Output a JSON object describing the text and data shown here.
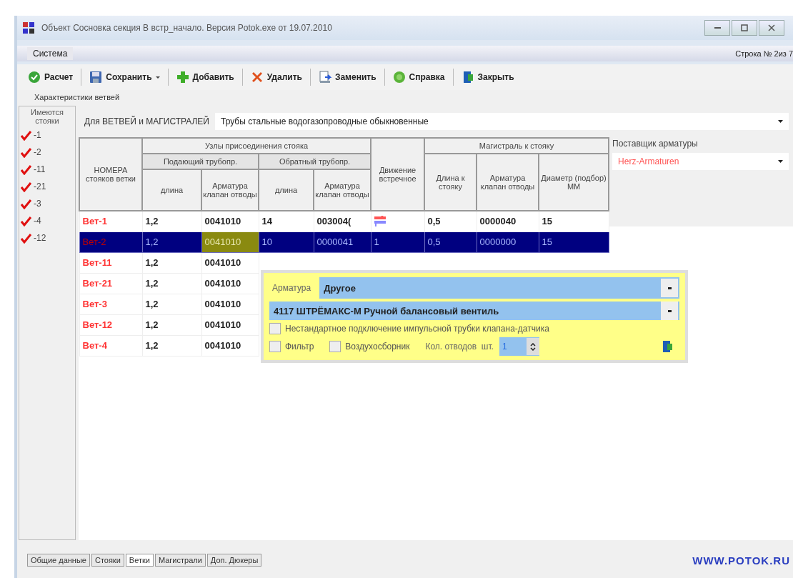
{
  "window": {
    "title": "Объект Сосновка секция В встр_начало. Версия Potok.exe от 19.07.2010"
  },
  "menu": [
    {
      "label": "Система"
    }
  ],
  "row_indicator": "Строка № 2из 7",
  "toolbar": [
    {
      "label": "Расчет",
      "dropdown": false
    },
    {
      "label": "Сохранить",
      "dropdown": true
    },
    {
      "label": "Добавить",
      "dropdown": false
    },
    {
      "label": "Удалить",
      "dropdown": false
    },
    {
      "label": "Заменить",
      "dropdown": false
    },
    {
      "label": "Справка",
      "dropdown": false
    },
    {
      "label": "Закрыть",
      "dropdown": false
    }
  ],
  "group_title": "Характеристики ветвей",
  "risers": {
    "title": "Имеются стояки",
    "items": [
      {
        "label": "-1",
        "checked": true
      },
      {
        "label": "-2",
        "checked": true
      },
      {
        "label": "-11",
        "checked": true
      },
      {
        "label": "-21",
        "checked": true
      },
      {
        "label": "-3",
        "checked": true
      },
      {
        "label": "-4",
        "checked": true
      },
      {
        "label": "-12",
        "checked": true
      }
    ]
  },
  "pipes": {
    "label": "Для ВЕТВЕЙ и МАГИСТРАЛЕЙ",
    "value": "Трубы стальные водогазопроводные обыкновенные"
  },
  "supplier": {
    "label": "Поставщик арматуры",
    "value": "Herz-Armaturen"
  },
  "table": {
    "header_rows": [
      [
        {
          "label": "НОМЕРА стояков ветки",
          "rowspan": 3
        },
        {
          "label": "Узлы присоединения стояка",
          "colspan": 4
        },
        {
          "label": "Движение встречное",
          "rowspan": 3
        },
        {
          "label": "Магистраль к стояку",
          "colspan": 3
        }
      ],
      [
        {
          "label": "Подающий трубопр.",
          "colspan": 2
        },
        {
          "label": "Обратный трубопр.",
          "colspan": 2
        },
        {
          "label": "Длина к стояку",
          "rowspan": 2
        },
        {
          "label": "Арматура клапан отводы",
          "rowspan": 2
        },
        {
          "label": "Диаметр (подбор) ММ",
          "rowspan": 2
        }
      ],
      [
        {
          "label": "длина"
        },
        {
          "label": "Арматура клапан отводы"
        },
        {
          "label": "длина"
        },
        {
          "label": "Арматура клапан отводы"
        }
      ]
    ],
    "rows": [
      {
        "selected": false,
        "cells": [
          {
            "kind": "name",
            "text": "Вет-1"
          },
          {
            "kind": "text",
            "text": "1,2"
          },
          {
            "kind": "text",
            "text": "0041010"
          },
          {
            "kind": "text",
            "text": "14"
          },
          {
            "kind": "text",
            "text": "003004("
          },
          {
            "kind": "flow"
          },
          {
            "kind": "text",
            "text": "0,5"
          },
          {
            "kind": "text",
            "text": "0000040"
          },
          {
            "kind": "text",
            "text": "15"
          }
        ]
      },
      {
        "selected": true,
        "cells": [
          {
            "kind": "name",
            "text": "Вет-2"
          },
          {
            "kind": "text",
            "text": "1,2"
          },
          {
            "kind": "text",
            "text": "0041010",
            "focused": true
          },
          {
            "kind": "text",
            "text": "10"
          },
          {
            "kind": "text",
            "text": "0000041"
          },
          {
            "kind": "text",
            "text": "1"
          },
          {
            "kind": "text",
            "text": "0,5"
          },
          {
            "kind": "text",
            "text": "0000000"
          },
          {
            "kind": "text",
            "text": "15"
          }
        ]
      },
      {
        "selected": false,
        "cells": [
          {
            "kind": "name",
            "text": "Вет-11"
          },
          {
            "kind": "text",
            "text": "1,2"
          },
          {
            "kind": "text",
            "text": "0041010"
          }
        ]
      },
      {
        "selected": false,
        "cells": [
          {
            "kind": "name",
            "text": "Вет-21"
          },
          {
            "kind": "text",
            "text": "1,2"
          },
          {
            "kind": "text",
            "text": "0041010"
          }
        ]
      },
      {
        "selected": false,
        "cells": [
          {
            "kind": "name",
            "text": "Вет-3"
          },
          {
            "kind": "text",
            "text": "1,2"
          },
          {
            "kind": "text",
            "text": "0041010"
          }
        ]
      },
      {
        "selected": false,
        "cells": [
          {
            "kind": "name",
            "text": "Вет-12"
          },
          {
            "kind": "text",
            "text": "1,2"
          },
          {
            "kind": "text",
            "text": "0041010"
          }
        ]
      },
      {
        "selected": false,
        "cells": [
          {
            "kind": "name",
            "text": "Вет-4"
          },
          {
            "kind": "text",
            "text": "1,2"
          },
          {
            "kind": "text",
            "text": "0041010"
          }
        ]
      }
    ]
  },
  "popup": {
    "fitting_label": "Арматура",
    "fitting_type": "Другое",
    "fitting_model": "4117 ШТРЁМАКС-М Ручной балансовый вентиль",
    "nonstandard": {
      "label": "Нестандартное подключение импульсной трубки клапана-датчика",
      "checked": false
    },
    "filter": {
      "label": "Фильтр",
      "checked": false
    },
    "air_vent": {
      "label": "Воздухосборник",
      "checked": false
    },
    "bends_label": "Кол. отводов  шт.",
    "bends_value": "1"
  },
  "bottom_tabs": [
    {
      "label": "Общие данные",
      "selected": false
    },
    {
      "label": "Стояки",
      "selected": false
    },
    {
      "label": "Ветки",
      "selected": true
    },
    {
      "label": "Магистрали",
      "selected": false
    },
    {
      "label": "Доп. Дюкеры",
      "selected": false
    }
  ],
  "website": "WWW.POTOK.RU"
}
